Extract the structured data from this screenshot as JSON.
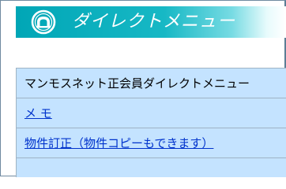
{
  "banner": {
    "title": "ダイレクトメニュー",
    "logo_icon": "arch-emblem-icon"
  },
  "menu": {
    "header": "マンモスネット正会員ダイレクトメニュー",
    "items": [
      {
        "label": "メ モ"
      },
      {
        "label": "物件訂正（物件コピーもできます）"
      }
    ]
  },
  "colors": {
    "banner_start": "#00a6b6",
    "menu_bg": "#c4e3ff",
    "link": "#0033cc"
  }
}
